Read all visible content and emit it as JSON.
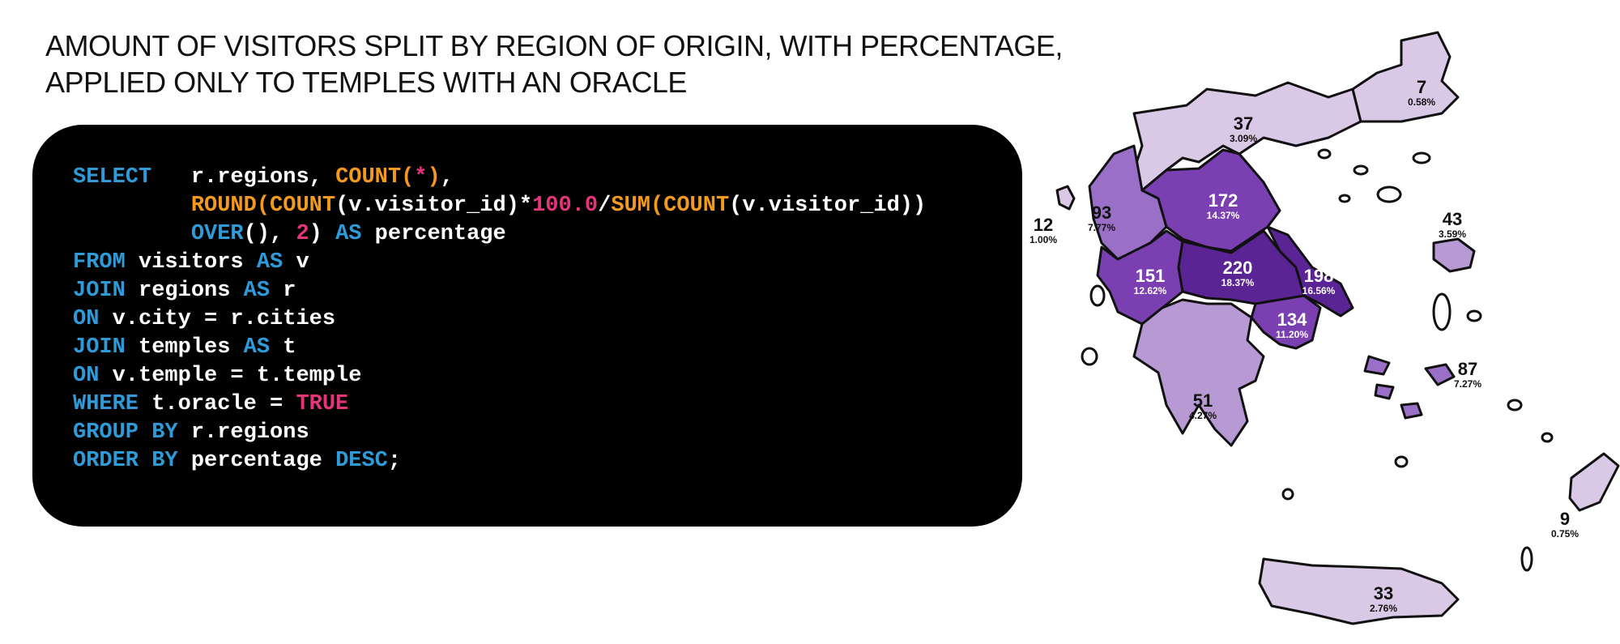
{
  "title": {
    "line1": "AMOUNT OF VISITORS SPLIT BY REGION OF ORIGIN, WITH PERCENTAGE,",
    "line2": "APPLIED ONLY TO TEMPLES WITH AN ORACLE"
  },
  "colors": {
    "keyword": "#2f9ad8",
    "function": "#f39a1e",
    "literal": "#e4357b",
    "text": "#ffffff",
    "background": "#000000",
    "region_light": "#d9c8e6",
    "region_mid": "#b79ad4",
    "region_strong": "#9a6fc8",
    "region_dark": "#7a3fb0",
    "region_darkest": "#5b2495",
    "border": "#111111"
  },
  "code": {
    "lines": [
      [
        {
          "t": "SELECT",
          "k": "keyword"
        },
        {
          "t": "   r.regions, ",
          "k": "text"
        },
        {
          "t": "COUNT",
          "k": "function"
        },
        {
          "t": "(",
          "k": "function"
        },
        {
          "t": "*",
          "k": "literal"
        },
        {
          "t": ")",
          "k": "function"
        },
        {
          "t": ",",
          "k": "text"
        }
      ],
      [
        {
          "t": "         ",
          "k": "text"
        },
        {
          "t": "ROUND",
          "k": "function"
        },
        {
          "t": "(",
          "k": "function"
        },
        {
          "t": "COUNT",
          "k": "function"
        },
        {
          "t": "(v.visitor_id)*",
          "k": "text"
        },
        {
          "t": "100.0",
          "k": "literal"
        },
        {
          "t": "/",
          "k": "text"
        },
        {
          "t": "SUM",
          "k": "function"
        },
        {
          "t": "(",
          "k": "function"
        },
        {
          "t": "COUNT",
          "k": "function"
        },
        {
          "t": "(v.visitor_id))",
          "k": "text"
        }
      ],
      [
        {
          "t": "         ",
          "k": "text"
        },
        {
          "t": "OVER",
          "k": "keyword"
        },
        {
          "t": "(), ",
          "k": "text"
        },
        {
          "t": "2",
          "k": "literal"
        },
        {
          "t": ") ",
          "k": "text"
        },
        {
          "t": "AS",
          "k": "keyword"
        },
        {
          "t": " percentage",
          "k": "text"
        }
      ],
      [
        {
          "t": "FROM",
          "k": "keyword"
        },
        {
          "t": " visitors ",
          "k": "text"
        },
        {
          "t": "AS",
          "k": "keyword"
        },
        {
          "t": " v",
          "k": "text"
        }
      ],
      [
        {
          "t": "JOIN",
          "k": "keyword"
        },
        {
          "t": " regions ",
          "k": "text"
        },
        {
          "t": "AS",
          "k": "keyword"
        },
        {
          "t": " r",
          "k": "text"
        }
      ],
      [
        {
          "t": "ON",
          "k": "keyword"
        },
        {
          "t": " v.city = r.cities",
          "k": "text"
        }
      ],
      [
        {
          "t": "JOIN",
          "k": "keyword"
        },
        {
          "t": " temples ",
          "k": "text"
        },
        {
          "t": "AS",
          "k": "keyword"
        },
        {
          "t": " t",
          "k": "text"
        }
      ],
      [
        {
          "t": "ON",
          "k": "keyword"
        },
        {
          "t": " v.temple = t.temple",
          "k": "text"
        }
      ],
      [
        {
          "t": "WHERE",
          "k": "keyword"
        },
        {
          "t": " t.oracle = ",
          "k": "text"
        },
        {
          "t": "TRUE",
          "k": "literal"
        }
      ],
      [
        {
          "t": "GROUP BY",
          "k": "keyword"
        },
        {
          "t": " r.regions",
          "k": "text"
        }
      ],
      [
        {
          "t": "ORDER BY",
          "k": "keyword"
        },
        {
          "t": " percentage ",
          "k": "text"
        },
        {
          "t": "DESC",
          "k": "keyword"
        },
        {
          "t": ";",
          "k": "text"
        }
      ]
    ]
  },
  "map": {
    "regions": [
      {
        "id": "macedonia",
        "count": "37",
        "percent": "3.09%",
        "shade": "region_light"
      },
      {
        "id": "thrace",
        "count": "7",
        "percent": "0.58%",
        "shade": "region_light"
      },
      {
        "id": "epirus",
        "count": "93",
        "percent": "7.77%",
        "shade": "region_strong"
      },
      {
        "id": "thessaly",
        "count": "172",
        "percent": "14.37%",
        "shade": "region_dark"
      },
      {
        "id": "corfu",
        "count": "12",
        "percent": "1.00%",
        "shade": "region_light"
      },
      {
        "id": "western-greece",
        "count": "151",
        "percent": "12.62%",
        "shade": "region_dark"
      },
      {
        "id": "central-greece",
        "count": "220",
        "percent": "18.37%",
        "shade": "region_darkest"
      },
      {
        "id": "euboea",
        "count": "198",
        "percent": "16.56%",
        "shade": "region_darkest"
      },
      {
        "id": "attica",
        "count": "134",
        "percent": "11.20%",
        "shade": "region_dark"
      },
      {
        "id": "peloponnese",
        "count": "51",
        "percent": "4.27%",
        "shade": "region_mid"
      },
      {
        "id": "north-aegean",
        "count": "43",
        "percent": "3.59%",
        "shade": "region_mid"
      },
      {
        "id": "south-aegean",
        "count": "87",
        "percent": "7.27%",
        "shade": "region_strong"
      },
      {
        "id": "dodecanese",
        "count": "9",
        "percent": "0.75%",
        "shade": "region_light"
      },
      {
        "id": "crete",
        "count": "33",
        "percent": "2.76%",
        "shade": "region_light"
      }
    ]
  }
}
